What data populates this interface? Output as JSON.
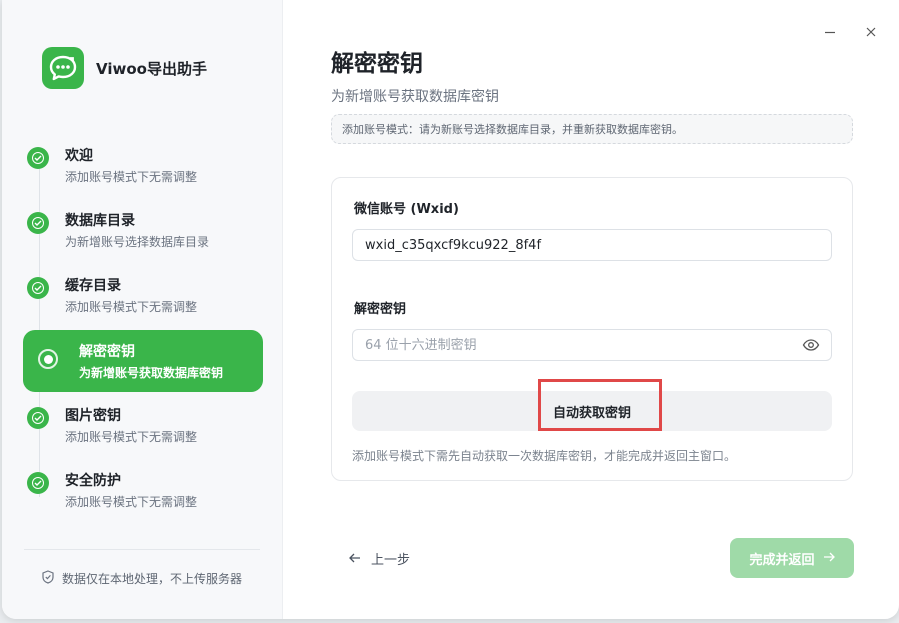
{
  "app": {
    "name": "Viwoo导出助手",
    "brand_color": "#3ab54a"
  },
  "window_controls": {
    "minimize_icon": "minimize-icon",
    "close_icon": "close-icon"
  },
  "sidebar": {
    "steps": [
      {
        "title": "欢迎",
        "desc": "添加账号模式下无需调整",
        "state": "done"
      },
      {
        "title": "数据库目录",
        "desc": "为新增账号选择数据库目录",
        "state": "done"
      },
      {
        "title": "缓存目录",
        "desc": "添加账号模式下无需调整",
        "state": "done"
      },
      {
        "title": "解密密钥",
        "desc": "为新增账号获取数据库密钥",
        "state": "active"
      },
      {
        "title": "图片密钥",
        "desc": "添加账号模式下无需调整",
        "state": "done"
      },
      {
        "title": "安全防护",
        "desc": "添加账号模式下无需调整",
        "state": "done"
      }
    ],
    "footer_note": "数据仅在本地处理，不上传服务器"
  },
  "main": {
    "title": "解密密钥",
    "subtitle": "为新增账号获取数据库密钥",
    "notice": "添加账号模式：请为新账号选择数据库目录，并重新获取数据库密钥。",
    "wxid_label": "微信账号 (Wxid)",
    "wxid_value": "wxid_c35qxcf9kcu922_8f4f",
    "key_label": "解密密钥",
    "key_placeholder": "64 位十六进制密钥",
    "key_value": "",
    "auto_button": "自动获取密钥",
    "hint": "添加账号模式下需先自动获取一次数据库密钥，才能完成并返回主窗口。",
    "prev_button": "上一步",
    "finish_button": "完成并返回"
  }
}
